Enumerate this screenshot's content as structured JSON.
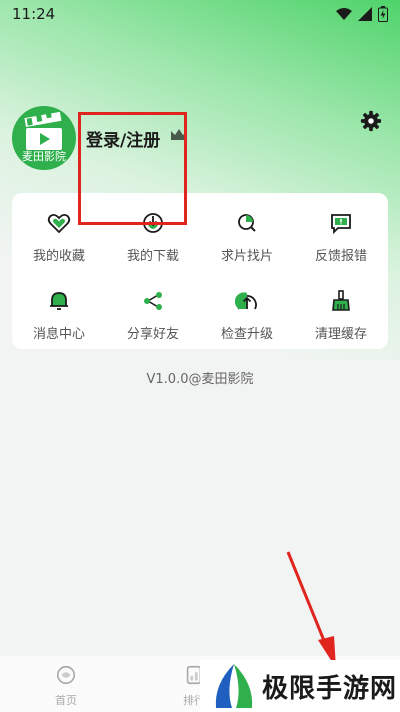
{
  "status_bar": {
    "time": "11:24",
    "icons": [
      "wifi-icon",
      "signal-icon",
      "battery-charging-icon"
    ]
  },
  "profile": {
    "avatar_label": "麦田影院",
    "login_label": "登录/注册",
    "vip_icon": "crown-icon",
    "settings_icon": "gear-icon"
  },
  "menu": {
    "items": [
      {
        "label": "我的收藏",
        "icon": "heart-icon"
      },
      {
        "label": "我的下载",
        "icon": "download-icon"
      },
      {
        "label": "求片找片",
        "icon": "search-film-icon"
      },
      {
        "label": "反馈报错",
        "icon": "feedback-icon"
      },
      {
        "label": "消息中心",
        "icon": "bell-icon"
      },
      {
        "label": "分享好友",
        "icon": "share-icon"
      },
      {
        "label": "检查升级",
        "icon": "upgrade-icon"
      },
      {
        "label": "清理缓存",
        "icon": "broom-icon"
      }
    ]
  },
  "version": "V1.0.0@麦田影院",
  "bottom_nav": {
    "items": [
      {
        "label": "首页"
      },
      {
        "label": "排行"
      }
    ]
  },
  "watermark": {
    "text": "极限手游网"
  },
  "colors": {
    "brand_green": "#2fb04c",
    "highlight_red": "#e0241e"
  }
}
